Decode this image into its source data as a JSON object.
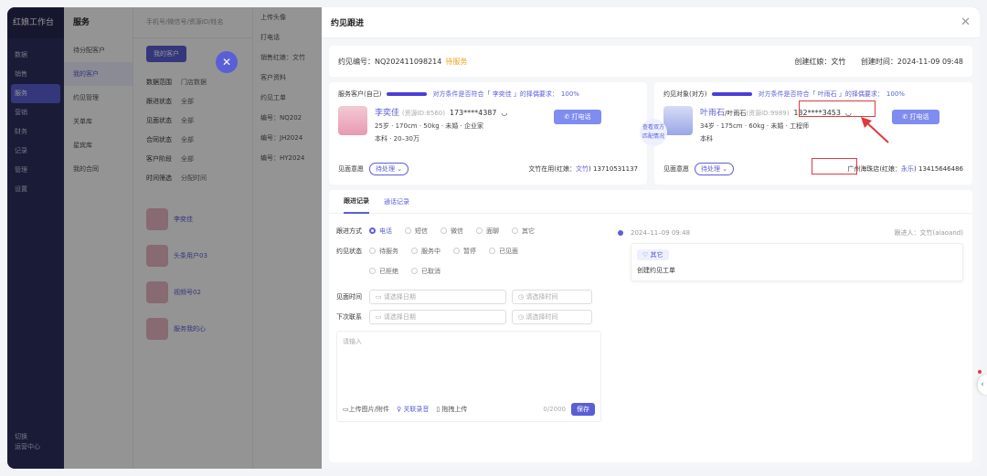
{
  "bg": {
    "brand": "红娘工作台",
    "nav": [
      "数据",
      "销售",
      "服务",
      "营销",
      "财务",
      "记录",
      "管理",
      "设置"
    ],
    "active_nav": 2,
    "foot": [
      "切换",
      "运营中心"
    ],
    "sub_title": "服务",
    "sub_items": [
      "待分配客户",
      "我的客户",
      "约见管理",
      "关单库",
      "星宾库",
      "我的合同"
    ],
    "search_placeholder": "手机号/微信号/资源ID/姓名",
    "tab": "我的客户",
    "filters": [
      {
        "k": "数据范围",
        "v": "门店数据"
      },
      {
        "k": "跟进状态",
        "v": "全部"
      },
      {
        "k": "见面状态",
        "v": "全部"
      },
      {
        "k": "合同状态",
        "v": "全部"
      },
      {
        "k": "客户阶段",
        "v": "全部"
      },
      {
        "k": "时间筛选",
        "v": "分配时间"
      }
    ],
    "list": [
      "李奕佳",
      "头条用户03",
      "视频号02",
      "服务我的心"
    ],
    "mid_labels": [
      "上传头像",
      "打电话",
      "销售红娘：文竹",
      "客户资料",
      "约见工单",
      "编号：NQ202",
      "编号：JH2024",
      "编号：HY2024"
    ]
  },
  "drawer": {
    "title": "约见跟进",
    "id_label": "约见编号：NQ202411098214",
    "status": "待服务",
    "creator": "创建红娘：文竹",
    "created": "创建时间：2024-11-09 09:48"
  },
  "left_card": {
    "head": "服务客户(自己)",
    "match_text": "对方条件是否符合「 李奕佳 」的择偶要求：",
    "pct": "100%",
    "name": "李奕佳",
    "res": "(资源ID:8560)",
    "phone": "173****4387",
    "detail1": "25岁 · 170cm · 50kg · 未婚 · 企业家",
    "detail2": "本科 · 20–30万",
    "call": "打电话",
    "intent_label": "见面意愿",
    "intent": "待处理",
    "store": "文竹在用(红娘：",
    "store_link": "文竹",
    "store_phone": ") 13710531137"
  },
  "center_link": [
    "查看双方",
    "匹配情况"
  ],
  "right_card": {
    "head": "约见对象(对方)",
    "match_text": "对方条件是否符合「 叶雨石 」的择偶要求：",
    "pct": "100%",
    "name": "叶雨石",
    "alias": "/叶雨石",
    "res": "(资源ID:9989)",
    "phone": "132****3453",
    "detail1": "34岁 · 175cm · 60kg · 未婚 · 工程师",
    "detail2": "本科",
    "call": "打电话",
    "intent_label": "见面意愿",
    "intent": "待处理",
    "store": "广州海珠店",
    "store_link": "永乐",
    "store_prefix": "(红娘：",
    "store_phone": ") 13415646486"
  },
  "follow": {
    "tabs": [
      "跟进记录",
      "通话记录"
    ],
    "method_label": "跟进方式",
    "methods": [
      "电话",
      "短信",
      "微信",
      "面聊",
      "其它"
    ],
    "status_label": "约见状态",
    "statuses": [
      "待服务",
      "服务中",
      "暂停",
      "已见面",
      "已拒绝",
      "已取消"
    ],
    "meet_label": "见面时间",
    "next_label": "下次联系",
    "date_ph": "请选择日期",
    "time_ph": "请选择时间",
    "textarea_ph": "请输入",
    "upload": "上传图片/附件",
    "record": "关联录音",
    "drag": "拖拽上传",
    "count": "0/2000",
    "save": "保存"
  },
  "timeline": {
    "time": "2024–11–09 09:48",
    "by": "跟进人：文竹(aiaoand)",
    "tag": "其它",
    "text": "创建约见工单"
  }
}
